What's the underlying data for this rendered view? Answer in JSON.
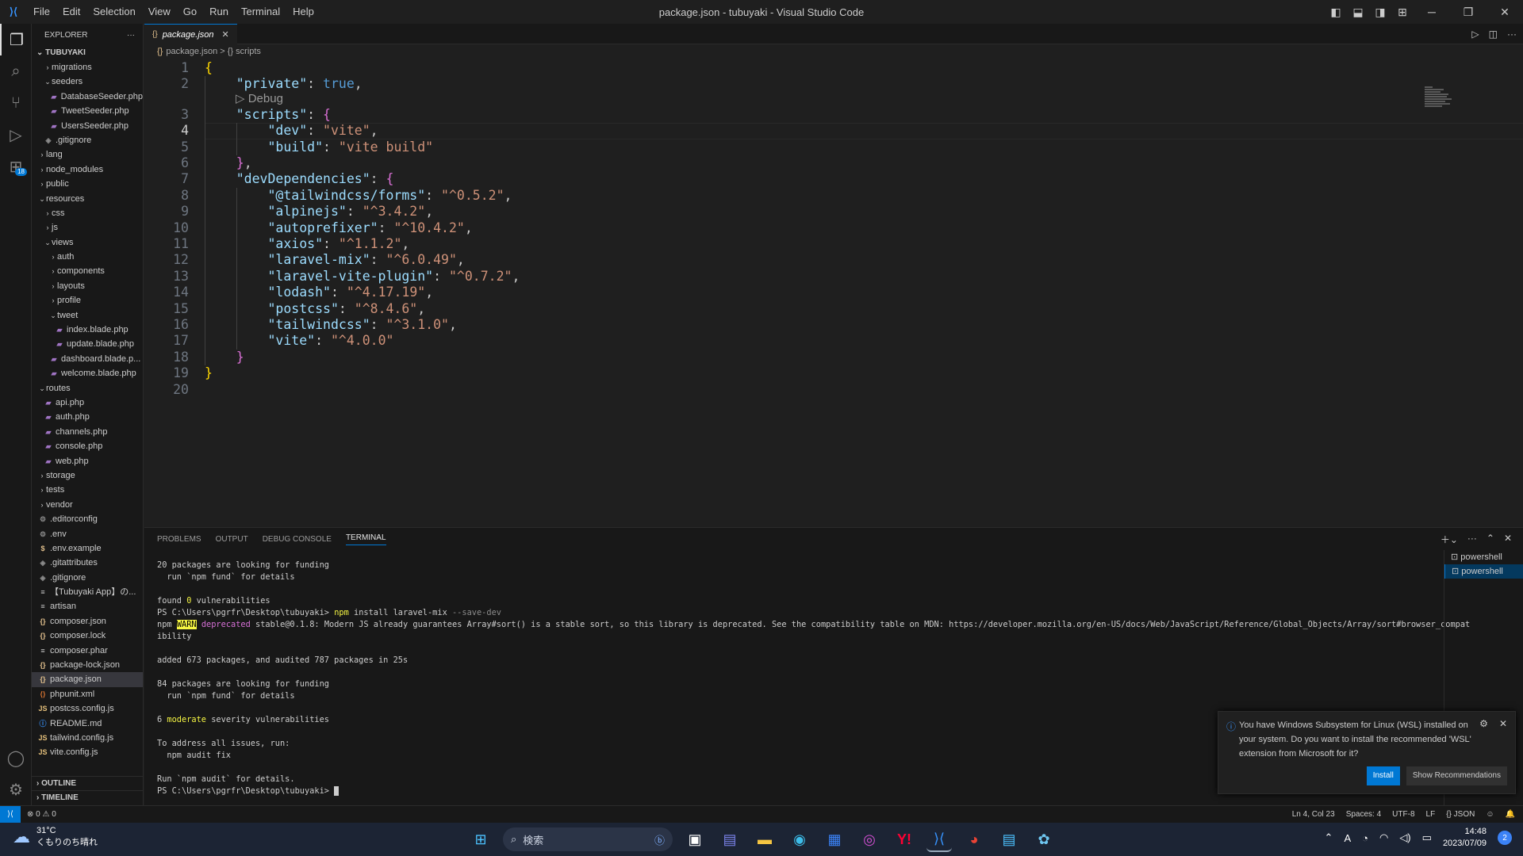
{
  "window": {
    "title": "package.json - tubuyaki - Visual Studio Code"
  },
  "menu": [
    "File",
    "Edit",
    "Selection",
    "View",
    "Go",
    "Run",
    "Terminal",
    "Help"
  ],
  "explorer": {
    "title": "EXPLORER",
    "root": "TUBUYAKI",
    "items": [
      {
        "label": "migrations",
        "type": "folder",
        "indent": 1,
        "open": false
      },
      {
        "label": "seeders",
        "type": "folder",
        "indent": 1,
        "open": true
      },
      {
        "label": "DatabaseSeeder.php",
        "type": "php",
        "indent": 2
      },
      {
        "label": "TweetSeeder.php",
        "type": "php",
        "indent": 2
      },
      {
        "label": "UsersSeeder.php",
        "type": "php",
        "indent": 2
      },
      {
        "label": ".gitignore",
        "type": "git",
        "indent": 1
      },
      {
        "label": "lang",
        "type": "folder",
        "indent": 0,
        "open": false
      },
      {
        "label": "node_modules",
        "type": "folder",
        "indent": 0,
        "open": false
      },
      {
        "label": "public",
        "type": "folder",
        "indent": 0,
        "open": false
      },
      {
        "label": "resources",
        "type": "folder",
        "indent": 0,
        "open": true
      },
      {
        "label": "css",
        "type": "folder",
        "indent": 1,
        "open": false
      },
      {
        "label": "js",
        "type": "folder",
        "indent": 1,
        "open": false
      },
      {
        "label": "views",
        "type": "folder",
        "indent": 1,
        "open": true
      },
      {
        "label": "auth",
        "type": "folder",
        "indent": 2,
        "open": false
      },
      {
        "label": "components",
        "type": "folder",
        "indent": 2,
        "open": false
      },
      {
        "label": "layouts",
        "type": "folder",
        "indent": 2,
        "open": false
      },
      {
        "label": "profile",
        "type": "folder",
        "indent": 2,
        "open": false
      },
      {
        "label": "tweet",
        "type": "folder",
        "indent": 2,
        "open": true
      },
      {
        "label": "index.blade.php",
        "type": "php",
        "indent": 3
      },
      {
        "label": "update.blade.php",
        "type": "php",
        "indent": 3
      },
      {
        "label": "dashboard.blade.p...",
        "type": "php",
        "indent": 2
      },
      {
        "label": "welcome.blade.php",
        "type": "php",
        "indent": 2
      },
      {
        "label": "routes",
        "type": "folder",
        "indent": 0,
        "open": true
      },
      {
        "label": "api.php",
        "type": "php",
        "indent": 1
      },
      {
        "label": "auth.php",
        "type": "php",
        "indent": 1
      },
      {
        "label": "channels.php",
        "type": "php",
        "indent": 1
      },
      {
        "label": "console.php",
        "type": "php",
        "indent": 1
      },
      {
        "label": "web.php",
        "type": "php",
        "indent": 1
      },
      {
        "label": "storage",
        "type": "folder",
        "indent": 0,
        "open": false
      },
      {
        "label": "tests",
        "type": "folder",
        "indent": 0,
        "open": false
      },
      {
        "label": "vendor",
        "type": "folder",
        "indent": 0,
        "open": false
      },
      {
        "label": ".editorconfig",
        "type": "gear",
        "indent": 0
      },
      {
        "label": ".env",
        "type": "gear",
        "indent": 0
      },
      {
        "label": ".env.example",
        "type": "dollar",
        "indent": 0
      },
      {
        "label": ".gitattributes",
        "type": "git",
        "indent": 0
      },
      {
        "label": ".gitignore",
        "type": "git",
        "indent": 0
      },
      {
        "label": "【Tubuyaki App】の...",
        "type": "doc",
        "indent": 0
      },
      {
        "label": "artisan",
        "type": "doc",
        "indent": 0
      },
      {
        "label": "composer.json",
        "type": "json",
        "indent": 0
      },
      {
        "label": "composer.lock",
        "type": "json",
        "indent": 0
      },
      {
        "label": "composer.phar",
        "type": "doc",
        "indent": 0
      },
      {
        "label": "package-lock.json",
        "type": "json",
        "indent": 0
      },
      {
        "label": "package.json",
        "type": "json",
        "indent": 0,
        "selected": true
      },
      {
        "label": "phpunit.xml",
        "type": "xml",
        "indent": 0
      },
      {
        "label": "postcss.config.js",
        "type": "js",
        "indent": 0
      },
      {
        "label": "README.md",
        "type": "info",
        "indent": 0
      },
      {
        "label": "tailwind.config.js",
        "type": "js",
        "indent": 0
      },
      {
        "label": "vite.config.js",
        "type": "js",
        "indent": 0
      }
    ],
    "outline": "OUTLINE",
    "timeline": "TIMELINE"
  },
  "tab": {
    "label": "package.json",
    "icon": "{}"
  },
  "breadcrumb": {
    "file": "package.json",
    "sep": ">",
    "node": "{} scripts"
  },
  "editor": {
    "cursor_line": 4,
    "codelens": "▷ Debug",
    "lines": [
      {
        "n": "1",
        "t": [
          [
            "br1",
            "{"
          ]
        ]
      },
      {
        "n": "2",
        "t": [
          [
            "pu",
            "    "
          ],
          [
            "k",
            "\"private\""
          ],
          [
            "pu",
            ": "
          ],
          [
            "b",
            "true"
          ],
          [
            "pu",
            ","
          ]
        ]
      },
      {
        "n": "3",
        "t": [
          [
            "pu",
            "    "
          ],
          [
            "k",
            "\"scripts\""
          ],
          [
            "pu",
            ": "
          ],
          [
            "br2",
            "{"
          ]
        ]
      },
      {
        "n": "4",
        "t": [
          [
            "pu",
            "        "
          ],
          [
            "k",
            "\"dev\""
          ],
          [
            "pu",
            ": "
          ],
          [
            "s",
            "\"vite\""
          ],
          [
            "pu",
            ","
          ]
        ]
      },
      {
        "n": "5",
        "t": [
          [
            "pu",
            "        "
          ],
          [
            "k",
            "\"build\""
          ],
          [
            "pu",
            ": "
          ],
          [
            "s",
            "\"vite build\""
          ]
        ]
      },
      {
        "n": "6",
        "t": [
          [
            "pu",
            "    "
          ],
          [
            "br2",
            "}"
          ],
          [
            "pu",
            ","
          ]
        ]
      },
      {
        "n": "7",
        "t": [
          [
            "pu",
            "    "
          ],
          [
            "k",
            "\"devDependencies\""
          ],
          [
            "pu",
            ": "
          ],
          [
            "br2",
            "{"
          ]
        ]
      },
      {
        "n": "8",
        "t": [
          [
            "pu",
            "        "
          ],
          [
            "k",
            "\"@tailwindcss/forms\""
          ],
          [
            "pu",
            ": "
          ],
          [
            "s",
            "\"^0.5.2\""
          ],
          [
            "pu",
            ","
          ]
        ]
      },
      {
        "n": "9",
        "t": [
          [
            "pu",
            "        "
          ],
          [
            "k",
            "\"alpinejs\""
          ],
          [
            "pu",
            ": "
          ],
          [
            "s",
            "\"^3.4.2\""
          ],
          [
            "pu",
            ","
          ]
        ]
      },
      {
        "n": "10",
        "t": [
          [
            "pu",
            "        "
          ],
          [
            "k",
            "\"autoprefixer\""
          ],
          [
            "pu",
            ": "
          ],
          [
            "s",
            "\"^10.4.2\""
          ],
          [
            "pu",
            ","
          ]
        ]
      },
      {
        "n": "11",
        "t": [
          [
            "pu",
            "        "
          ],
          [
            "k",
            "\"axios\""
          ],
          [
            "pu",
            ": "
          ],
          [
            "s",
            "\"^1.1.2\""
          ],
          [
            "pu",
            ","
          ]
        ]
      },
      {
        "n": "12",
        "t": [
          [
            "pu",
            "        "
          ],
          [
            "k",
            "\"laravel-mix\""
          ],
          [
            "pu",
            ": "
          ],
          [
            "s",
            "\"^6.0.49\""
          ],
          [
            "pu",
            ","
          ]
        ]
      },
      {
        "n": "13",
        "t": [
          [
            "pu",
            "        "
          ],
          [
            "k",
            "\"laravel-vite-plugin\""
          ],
          [
            "pu",
            ": "
          ],
          [
            "s",
            "\"^0.7.2\""
          ],
          [
            "pu",
            ","
          ]
        ]
      },
      {
        "n": "14",
        "t": [
          [
            "pu",
            "        "
          ],
          [
            "k",
            "\"lodash\""
          ],
          [
            "pu",
            ": "
          ],
          [
            "s",
            "\"^4.17.19\""
          ],
          [
            "pu",
            ","
          ]
        ]
      },
      {
        "n": "15",
        "t": [
          [
            "pu",
            "        "
          ],
          [
            "k",
            "\"postcss\""
          ],
          [
            "pu",
            ": "
          ],
          [
            "s",
            "\"^8.4.6\""
          ],
          [
            "pu",
            ","
          ]
        ]
      },
      {
        "n": "16",
        "t": [
          [
            "pu",
            "        "
          ],
          [
            "k",
            "\"tailwindcss\""
          ],
          [
            "pu",
            ": "
          ],
          [
            "s",
            "\"^3.1.0\""
          ],
          [
            "pu",
            ","
          ]
        ]
      },
      {
        "n": "17",
        "t": [
          [
            "pu",
            "        "
          ],
          [
            "k",
            "\"vite\""
          ],
          [
            "pu",
            ": "
          ],
          [
            "s",
            "\"^4.0.0\""
          ]
        ]
      },
      {
        "n": "18",
        "t": [
          [
            "pu",
            "    "
          ],
          [
            "br2",
            "}"
          ]
        ]
      },
      {
        "n": "19",
        "t": [
          [
            "br1",
            "}"
          ]
        ]
      },
      {
        "n": "20",
        "t": []
      }
    ]
  },
  "panel": {
    "tabs": [
      "PROBLEMS",
      "OUTPUT",
      "DEBUG CONSOLE",
      "TERMINAL"
    ],
    "active_tab": "TERMINAL",
    "terminals": [
      "powershell",
      "powershell"
    ],
    "terminal_lines": [
      [
        [
          "",
          "20 packages are looking for funding"
        ]
      ],
      [
        [
          "",
          "  run `npm fund` for details"
        ]
      ],
      [
        [
          "",
          ""
        ]
      ],
      [
        [
          "",
          "found "
        ],
        [
          "yl",
          "0"
        ],
        [
          "",
          " vulnerabilities"
        ]
      ],
      [
        [
          "",
          "PS C:\\Users\\pgrfr\\Desktop\\tubuyaki> "
        ],
        [
          "yl",
          "npm"
        ],
        [
          "",
          " install laravel-mix "
        ],
        [
          "gy",
          "--save-dev"
        ]
      ],
      [
        [
          "",
          "npm "
        ],
        [
          "warn",
          "WARN"
        ],
        [
          "",
          " "
        ],
        [
          "mg",
          "deprecated"
        ],
        [
          "",
          " stable@0.1.8: Modern JS already guarantees Array#sort() is a stable sort, so this library is deprecated. See the compatibility table on MDN: https://developer.mozilla.org/en-US/docs/Web/JavaScript/Reference/Global_Objects/Array/sort#browser_compat"
        ]
      ],
      [
        [
          "",
          "ibility"
        ]
      ],
      [
        [
          "",
          ""
        ]
      ],
      [
        [
          "",
          "added 673 packages, and audited 787 packages in 25s"
        ]
      ],
      [
        [
          "",
          ""
        ]
      ],
      [
        [
          "",
          "84 packages are looking for funding"
        ]
      ],
      [
        [
          "",
          "  run `npm fund` for details"
        ]
      ],
      [
        [
          "",
          ""
        ]
      ],
      [
        [
          "",
          "6 "
        ],
        [
          "yl",
          "moderate"
        ],
        [
          "",
          " severity vulnerabilities"
        ]
      ],
      [
        [
          "",
          ""
        ]
      ],
      [
        [
          "",
          "To address all issues, run:"
        ]
      ],
      [
        [
          "",
          "  npm audit fix"
        ]
      ],
      [
        [
          "",
          ""
        ]
      ],
      [
        [
          "",
          "Run `npm audit` for details."
        ]
      ],
      [
        [
          "",
          "PS C:\\Users\\pgrfr\\Desktop\\tubuyaki> "
        ]
      ]
    ]
  },
  "notification": {
    "message": "You have Windows Subsystem for Linux (WSL) installed on your system. Do you want to install the recommended 'WSL' extension from Microsoft for it?",
    "install": "Install",
    "show": "Show Recommendations"
  },
  "status": {
    "errors": "⊗ 0 ⚠ 0",
    "position": "Ln 4, Col 23",
    "spaces": "Spaces: 4",
    "encoding": "UTF-8",
    "eol": "LF",
    "language": "{} JSON"
  },
  "taskbar": {
    "temp": "31°C",
    "weather": "くもりのち晴れ",
    "search": "検索",
    "time": "14:48",
    "date": "2023/07/09",
    "notifications": "2"
  }
}
